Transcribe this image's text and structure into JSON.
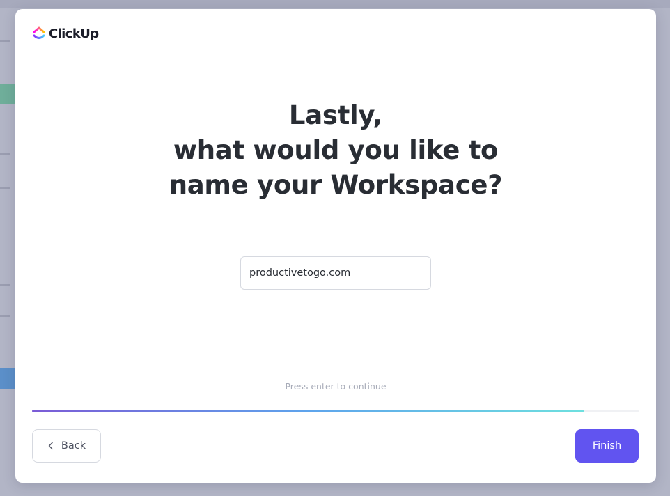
{
  "brand": {
    "name": "ClickUp",
    "logo_icon": "clickup-logo-icon"
  },
  "onboarding": {
    "title_lines": [
      "Lastly,",
      "what would you like to",
      "name your Workspace?"
    ],
    "workspace_input": {
      "value": "productivetogo.com",
      "placeholder": ""
    },
    "hint": "Press enter to continue",
    "progress_fraction": 0.91,
    "back_label": "Back",
    "back_icon": "chevron-left-icon",
    "finish_label": "Finish"
  },
  "colors": {
    "accent": "#6154f0",
    "title": "#292d34",
    "progress_start": "#7b5bd6",
    "progress_mid": "#5ea4ec",
    "progress_end": "#6ee0df"
  }
}
